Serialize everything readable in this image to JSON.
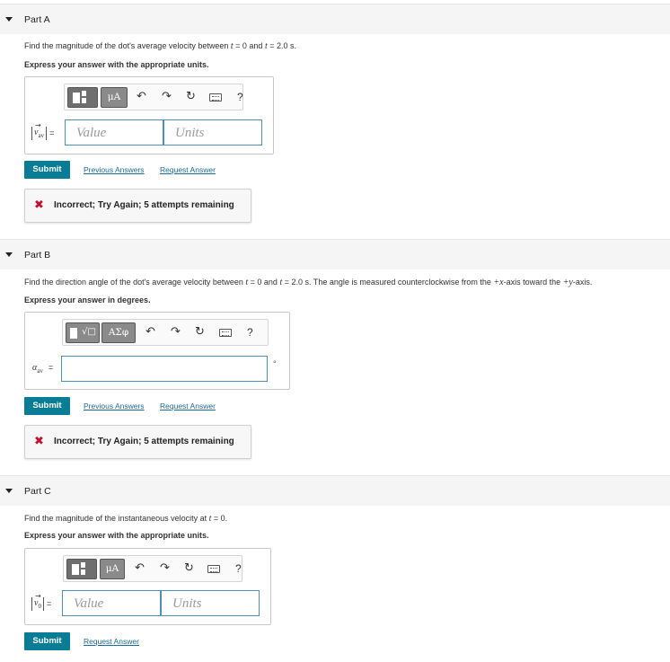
{
  "parts": {
    "a": {
      "title": "Part A",
      "question_pre": "Find the magnitude of the dot's average velocity between ",
      "t_var": "t",
      "eq0": " = 0 and ",
      "eq1": " = 2.0 s.",
      "instruction": "Express your answer with the appropriate units.",
      "var_symbol": "v",
      "var_sub": "av",
      "value_placeholder": "Value",
      "units_placeholder": "Units",
      "submit_label": "Submit",
      "prev_answers": "Previous Answers",
      "request_answer": "Request Answer",
      "feedback": "Incorrect; Try Again; 5 attempts remaining"
    },
    "b": {
      "title": "Part B",
      "question_pre": "Find the direction angle of the dot's average velocity between ",
      "t_var": "t",
      "eq0": " = 0 and ",
      "eq1": " = 2.0 s. The angle is measured counterclockwise from the ",
      "x_axis": "+x",
      "mid": "-axis toward the ",
      "y_axis": "+y",
      "end": "-axis.",
      "instruction": "Express your answer in degrees.",
      "var_symbol": "α",
      "var_sub": "av",
      "degree_symbol": "°",
      "submit_label": "Submit",
      "prev_answers": "Previous Answers",
      "request_answer": "Request Answer",
      "feedback": "Incorrect; Try Again; 5 attempts remaining"
    },
    "c": {
      "title": "Part C",
      "question_pre": "Find the magnitude of the instantaneous velocity at ",
      "t_var": "t",
      "eq0": " = 0.",
      "instruction": "Express your answer with the appropriate units.",
      "var_symbol": "v",
      "var_sub": "0",
      "value_placeholder": "Value",
      "units_placeholder": "Units",
      "submit_label": "Submit",
      "request_answer": "Request Answer"
    }
  },
  "toolbar": {
    "units_label": "μA",
    "greek_label": "ΑΣφ",
    "undo_icon": "↶",
    "redo_icon": "↷",
    "reset_icon": "↻",
    "help_label": "?"
  },
  "colors": {
    "submit_bg": "#0a7d96",
    "link": "#1a6a93",
    "error_x": "#c8102e",
    "field_border": "#4a90b8"
  }
}
